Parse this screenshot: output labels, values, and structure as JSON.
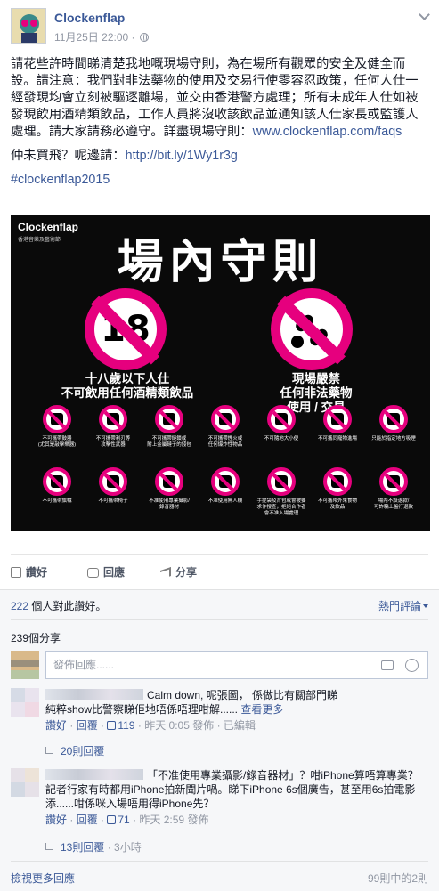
{
  "post": {
    "page_name": "Clockenflap",
    "timestamp": "11月25日 22:00 ·",
    "paragraphs": [
      "請花些許時間睇清楚我地嘅現場守則，為在場所有觀眾的安全及健全而設。請注意：我們對非法藥物的使用及交易行使零容忍政策，任何人仕一經發現均會立刻被驅逐離場，並交由香港警方處理；所有未成年人仕如被發現飲用酒精類飲品，工作人員將沒收該飲品並通知該人仕家長或監護人處理。請大家請務必遵守。詳盡現場守則：",
      "仲未買飛？呢邊請："
    ],
    "faq_link": "www.clockenflap.com/faqs",
    "ticket_link": "http://bit.ly/1Wy1r3g",
    "hashtag": "#clockenflap2015"
  },
  "poster": {
    "logo": "Clockenflap",
    "logo_sub": "香港音樂及藝術節",
    "title": "場內守則",
    "sign_number": "18",
    "caption_left": "十八歲以下人仕\n不可飲用任何酒精類飲品",
    "caption_right": "現場嚴禁\n任何非法藥物\n使用 / 交易",
    "small_signs": [
      "不可攜帶鼓器\n(尤其是敲擊樂器)",
      "不可攜帶利刃等\n攻擊性武器",
      "不可攜帶鏈鎖或\n附上金屬鏈子的錢包",
      "不可攜帶煙火或\n任何爆炸性物品",
      "不可隨地大小便",
      "不可攜同寵物進場",
      "只能於指定地方吸煙",
      "不可攜帶旗幟",
      "不可攜帶椅子",
      "不准使用專業攝影/\n錄音器材",
      "不准使用無人機",
      "手提袋及背包或會被要\n求作搜查，拒絕合作者\n會不准入場處理",
      "不可攜帶外來食物\n及飲品",
      "場內不設退款/\n可詐騙上盤行退款"
    ]
  },
  "actions": {
    "like": "讚好",
    "comment": "回應",
    "share": "分享"
  },
  "ufi": {
    "likes_count": "222",
    "likes_suffix": " 個人對此讚好。",
    "top_comments": "熱門評論",
    "shares": "239個分享",
    "composer_placeholder": "發佈回應......",
    "comments": [
      {
        "text": "Calm down, 呢張圖， 係做比有關部門睇\n純粹show比警察睇佢地唔係唔理咁解......",
        "more": "查看更多",
        "like": "讚好",
        "reply": "回覆",
        "likes": "119",
        "time": "昨天 0:05",
        "tail": "發佈 · 已編輯",
        "replies": "20則回覆",
        "replies_extra": ""
      },
      {
        "text": "「不准使用專業攝影/錄音器材」？咁iPhone算唔算專業？記者行家有時都用iPhone拍新聞片喎。睇下iPhone 6s個廣告，甚至用6s拍電影添......咁係咪入場唔用得iPhone先？",
        "more": "",
        "like": "讚好",
        "reply": "回覆",
        "likes": "71",
        "time": "昨天 2:59",
        "tail": "發佈",
        "replies": "13則回覆",
        "replies_extra": " · 3小時"
      }
    ],
    "view_more": "檢視更多回應",
    "count_info": "99則中的2則"
  },
  "colors": {
    "brand_blue": "#3b5998",
    "poster_magenta": "#e6007e"
  }
}
